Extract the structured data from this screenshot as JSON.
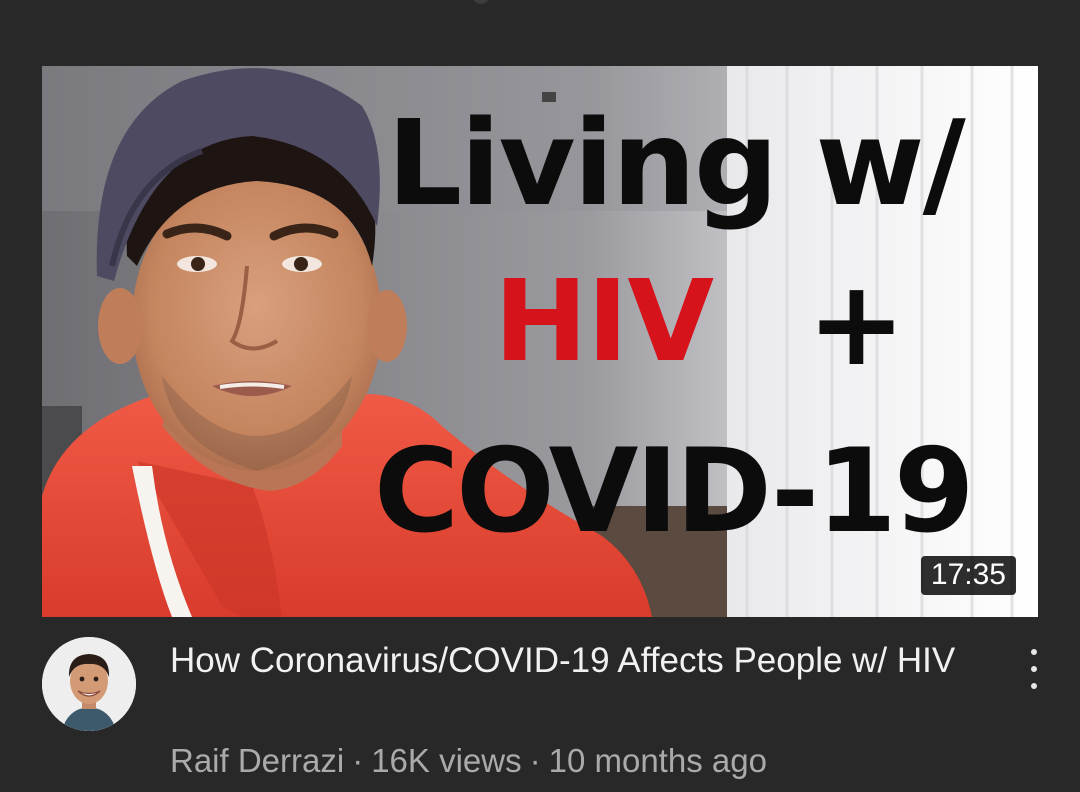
{
  "thumbnail": {
    "overlay_line1": "Living w/",
    "overlay_hiv": "HIV",
    "overlay_plus": "+",
    "overlay_line3": "COVID-19",
    "duration": "17:35",
    "colors": {
      "text_black": "#0c0c0c",
      "text_red": "#d6121b",
      "hoodie": "#e8483a"
    }
  },
  "video": {
    "title": "How Coronavirus/COVID-19 Affects People w/ HIV",
    "channel": "Raif Derrazi",
    "separator": "·",
    "views": "16K views",
    "age": "10 months ago"
  },
  "icons": {
    "menu": "more-vertical-icon",
    "avatar": "channel-avatar"
  },
  "theme": {
    "background": "#282828",
    "title_color": "#f1f1f1",
    "secondary_text": "#aaaaaa"
  }
}
